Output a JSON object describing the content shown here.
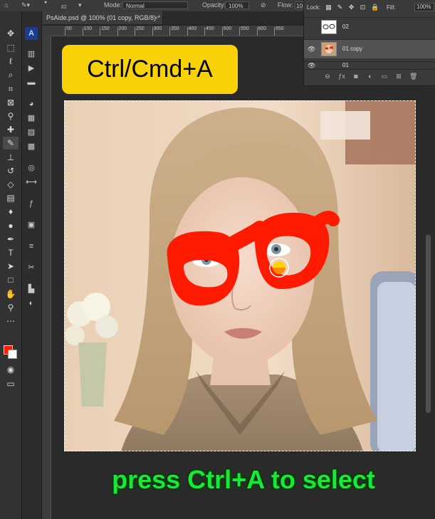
{
  "options_bar": {
    "brush_size": "62",
    "mode_label": "Mode:",
    "mode_value": "Normal",
    "opacity_label": "Opacity:",
    "opacity_value": "100%",
    "flow_label": "Flow:",
    "flow_value": "10"
  },
  "document": {
    "tab_title": "PsAide.psd @ 100% (01 copy, RGB/8) *",
    "close_glyph": "×"
  },
  "ruler": {
    "ticks": [
      "50",
      "100",
      "150",
      "200",
      "250",
      "300",
      "350",
      "400",
      "450",
      "500",
      "550",
      "600",
      "650"
    ]
  },
  "layers_panel": {
    "lock_label": "Lock:",
    "fill_label": "Fill:",
    "fill_value": "100%",
    "layers": [
      {
        "name": "02",
        "visible": false,
        "selected": false
      },
      {
        "name": "01 copy",
        "visible": true,
        "selected": true
      },
      {
        "name": "01",
        "visible": true,
        "selected": false
      }
    ]
  },
  "overlay": {
    "shortcut_text": "Ctrl/Cmd+A",
    "caption": "press Ctrl+A to select"
  },
  "tools": [
    "move-tool-icon",
    "marquee-tool-icon",
    "lasso-tool-icon",
    "quick-select-tool-icon",
    "crop-tool-icon",
    "frame-tool-icon",
    "eyedropper-tool-icon",
    "healing-brush-tool-icon",
    "brush-tool-icon",
    "clone-stamp-tool-icon",
    "history-brush-tool-icon",
    "eraser-tool-icon",
    "gradient-tool-icon",
    "blur-tool-icon",
    "dodge-tool-icon",
    "pen-tool-icon",
    "type-tool-icon",
    "path-select-tool-icon",
    "rectangle-tool-icon",
    "hand-tool-icon",
    "zoom-tool-icon",
    "more-tools-icon"
  ],
  "colors": {
    "foreground": "#ff1a00",
    "background": "#ffffff",
    "accent_badge": "#f8d107",
    "caption": "#19e83a"
  }
}
